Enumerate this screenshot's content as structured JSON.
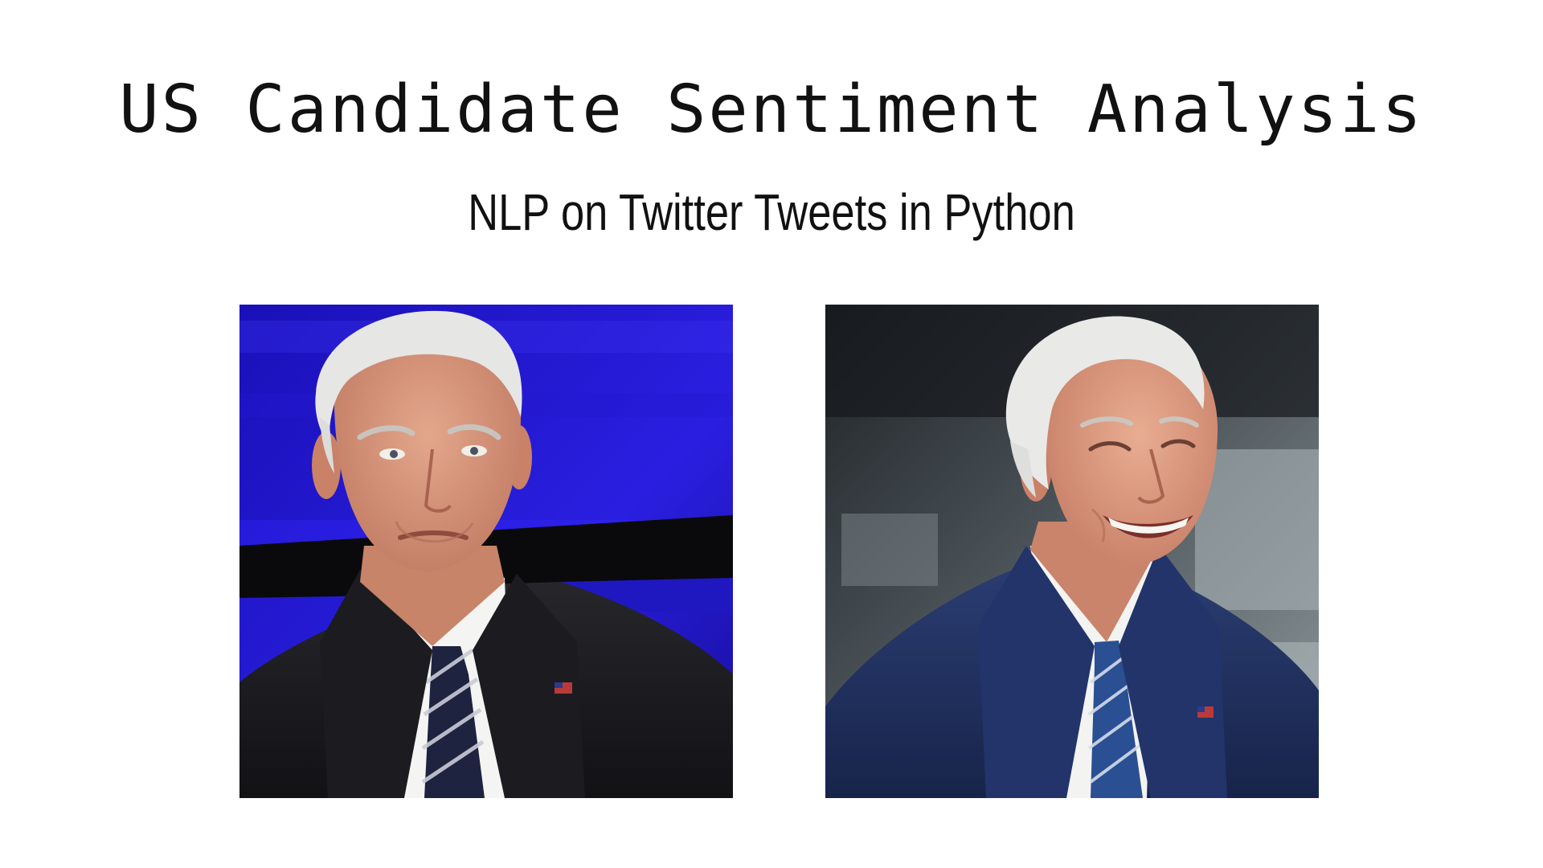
{
  "slide": {
    "title": "US Candidate Sentiment Analysis",
    "subtitle": "NLP on Twitter Tweets in Python"
  },
  "photos": [
    {
      "name": "candidate-photo-serious",
      "expression": "serious",
      "background": "blue-stage"
    },
    {
      "name": "candidate-photo-smiling",
      "expression": "smiling",
      "background": "blurred-grey"
    }
  ],
  "colors": {
    "background": "#ffffff",
    "text": "#111111",
    "stage_blue": "#1a10c8",
    "suit_dark": "#1b1b1f",
    "suit_navy": "#1f2f5e",
    "hair": "#e4e4e2",
    "skin": "#d9977e"
  }
}
